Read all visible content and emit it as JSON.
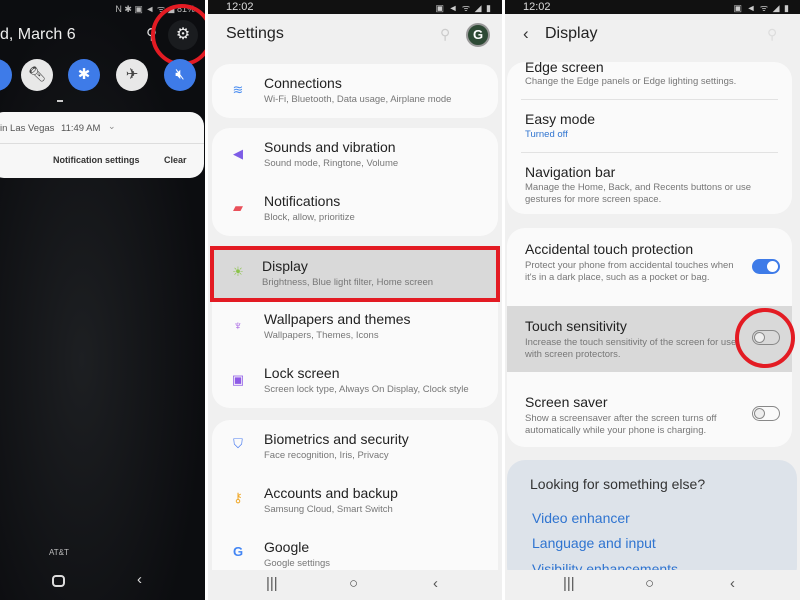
{
  "left": {
    "status_icons": "N ✱ ▣ ◄ ᯤ ◢ 81%",
    "date": "d, March 6",
    "notification": {
      "text": "in Las Vegas",
      "time": "11:49 AM",
      "settings_label": "Notification settings",
      "clear_label": "Clear"
    },
    "carrier": "AT&T"
  },
  "mid": {
    "time": "12:02",
    "title": "Settings",
    "items": [
      {
        "title": "Connections",
        "sub": "Wi-Fi, Bluetooth, Data usage, Airplane mode",
        "icon": "wifi-icon",
        "color": "#4a8df0"
      },
      {
        "title": "Sounds and vibration",
        "sub": "Sound mode, Ringtone, Volume",
        "icon": "volume-icon",
        "color": "#7d5ce6"
      },
      {
        "title": "Notifications",
        "sub": "Block, allow, prioritize",
        "icon": "notification-icon",
        "color": "#e9505a"
      },
      {
        "title": "Display",
        "sub": "Brightness, Blue light filter, Home screen",
        "icon": "brightness-icon",
        "color": "#8bc34a"
      },
      {
        "title": "Wallpapers and themes",
        "sub": "Wallpapers, Themes, Icons",
        "icon": "brush-icon",
        "color": "#9b4de0"
      },
      {
        "title": "Lock screen",
        "sub": "Screen lock type, Always On Display, Clock style",
        "icon": "lock-icon",
        "color": "#8e5ae6"
      },
      {
        "title": "Biometrics and security",
        "sub": "Face recognition, Iris, Privacy",
        "icon": "shield-icon",
        "color": "#4d7ef0"
      },
      {
        "title": "Accounts and backup",
        "sub": "Samsung Cloud, Smart Switch",
        "icon": "key-icon",
        "color": "#f0a92b"
      },
      {
        "title": "Google",
        "sub": "Google settings",
        "icon": "google-icon",
        "color": "#4285f4"
      }
    ]
  },
  "right": {
    "time": "12:02",
    "title": "Display",
    "items": [
      {
        "title": "Edge screen",
        "sub": "Change the Edge panels or Edge lighting settings."
      },
      {
        "title": "Easy mode",
        "sub": "Turned off"
      },
      {
        "title": "Navigation bar",
        "sub": "Manage the Home, Back, and Recents buttons or use gestures for more screen space."
      },
      {
        "title": "Accidental touch protection",
        "sub": "Protect your phone from accidental touches when it's in a dark place, such as a pocket or bag.",
        "on": true
      },
      {
        "title": "Touch sensitivity",
        "sub": "Increase the touch sensitivity of the screen for use with screen protectors.",
        "on": false
      },
      {
        "title": "Screen saver",
        "sub": "Show a screensaver after the screen turns off automatically while your phone is charging.",
        "on": false
      }
    ],
    "looking": {
      "title": "Looking for something else?",
      "links": [
        "Video enhancer",
        "Language and input",
        "Visibility enhancements"
      ]
    }
  },
  "colors": {
    "accent": "#2f74d0",
    "highlight": "#e31b23",
    "toggle_on": "#3e7be8"
  }
}
